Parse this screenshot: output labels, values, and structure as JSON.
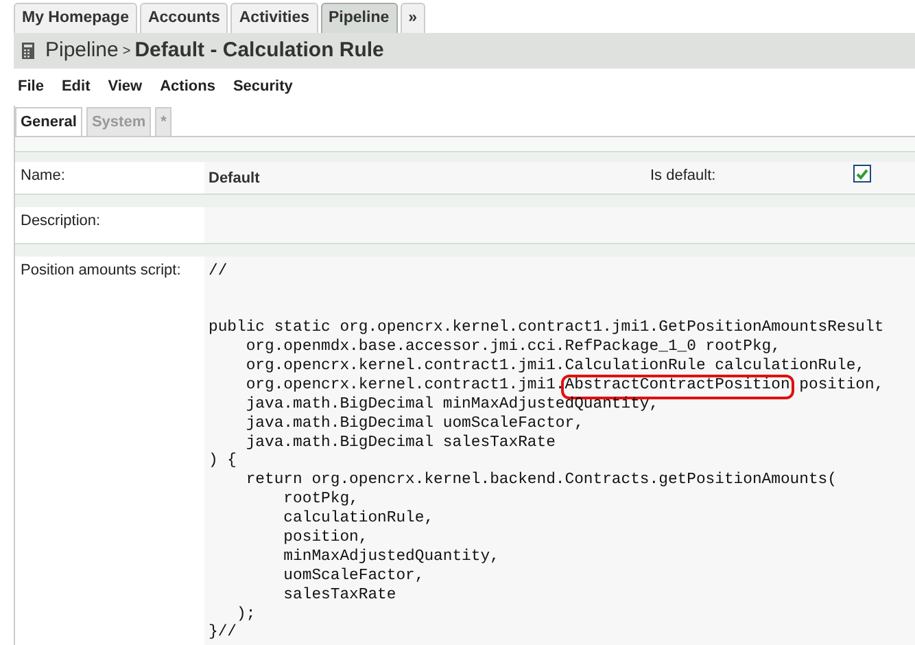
{
  "top_tabs": [
    {
      "label": "My Homepage",
      "selected": false
    },
    {
      "label": "Accounts",
      "selected": false
    },
    {
      "label": "Activities",
      "selected": false
    },
    {
      "label": "Pipeline",
      "selected": true
    },
    {
      "label": "»",
      "selected": false
    }
  ],
  "header": {
    "breadcrumb": "Pipeline",
    "separator": ">",
    "title": "Default - Calculation Rule"
  },
  "menu": [
    "File",
    "Edit",
    "View",
    "Actions",
    "Security"
  ],
  "sub_tabs": [
    {
      "label": "General",
      "selected": true
    },
    {
      "label": "System",
      "selected": false
    },
    {
      "label": "*",
      "selected": false
    }
  ],
  "fields": [
    {
      "label": "Name:",
      "value": "Default",
      "side_label": "Is default:",
      "side_checked": true
    },
    {
      "label": "Description:"
    },
    {
      "label": "Position amounts script:",
      "code": [
        [
          {
            "text": "//",
            "highlighted": false
          }
        ],
        {
          "kind": "blank"
        },
        {
          "kind": "blank"
        },
        [
          {
            "text": "public static org.opencrx.kernel.contract1.jmi1.GetPositionAmountsResult",
            "highlighted": false
          }
        ],
        [
          {
            "text": "    org.openmdx.base.accessor.jmi.cci.RefPackage_1_0 rootPkg,",
            "highlighted": false
          }
        ],
        [
          {
            "text": "    org.opencrx.kernel.contract1.jmi1.CalculationRule calculationRule,",
            "highlighted": false
          }
        ],
        [
          {
            "text": "    org.opencrx.kernel.contract1.jmi1.",
            "highlighted": false
          },
          {
            "text": "AbstractContractPosition",
            "highlighted": true
          },
          {
            "text": " position,",
            "highlighted": false
          }
        ],
        [
          {
            "text": "    java.math.BigDecimal minMaxAdjustedQuantity,",
            "highlighted": false
          }
        ],
        [
          {
            "text": "    java.math.BigDecimal uomScaleFactor,",
            "highlighted": false
          }
        ],
        [
          {
            "text": "    java.math.BigDecimal salesTaxRate",
            "highlighted": false
          }
        ],
        [
          {
            "text": ") {",
            "highlighted": false
          }
        ],
        [
          {
            "text": "    return org.opencrx.kernel.backend.Contracts.getPositionAmounts(",
            "highlighted": false
          }
        ],
        [
          {
            "text": "        rootPkg,",
            "highlighted": false
          }
        ],
        [
          {
            "text": "        calculationRule,",
            "highlighted": false
          }
        ],
        [
          {
            "text": "        position,",
            "highlighted": false
          }
        ],
        [
          {
            "text": "        minMaxAdjustedQuantity,",
            "highlighted": false
          }
        ],
        [
          {
            "text": "        uomScaleFactor,",
            "highlighted": false
          }
        ],
        [
          {
            "text": "        salesTaxRate",
            "highlighted": false
          }
        ],
        [
          {
            "text": "   );",
            "highlighted": false
          }
        ],
        [
          {
            "text": "}//",
            "highlighted": false
          }
        ]
      ]
    }
  ]
}
